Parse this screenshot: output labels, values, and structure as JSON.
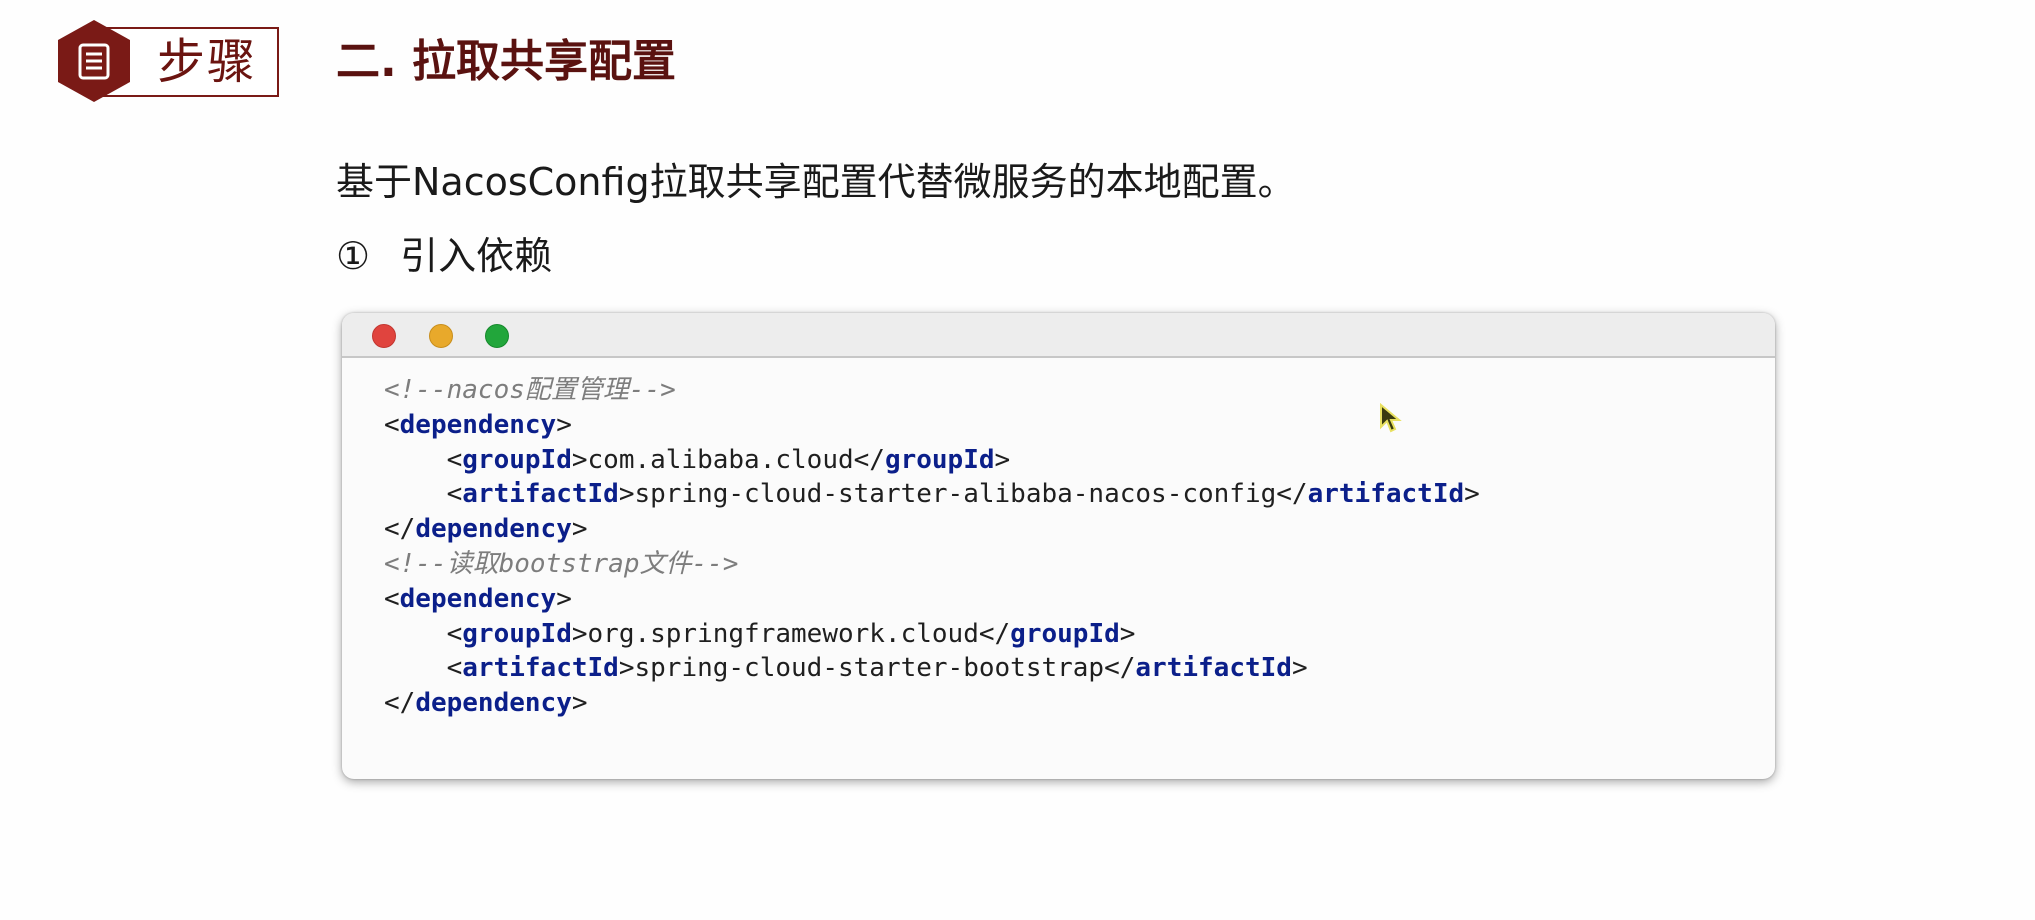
{
  "badge": {
    "label": "步骤",
    "icon": "document-icon",
    "color": "#7a1a16"
  },
  "section_title": "二. 拉取共享配置",
  "intro": "基于NacosConfig拉取共享配置代替微服务的本地配置。",
  "step": {
    "number": "①",
    "text": "引入依赖"
  },
  "code_window": {
    "window_buttons": [
      "close",
      "minimize",
      "maximize"
    ],
    "lines": [
      {
        "type": "comment",
        "text": "<!--nacos配置管理-->"
      },
      {
        "type": "open",
        "indent": 0,
        "tag": "dependency"
      },
      {
        "type": "element",
        "indent": 1,
        "tag": "groupId",
        "value": "com.alibaba.cloud"
      },
      {
        "type": "element",
        "indent": 1,
        "tag": "artifactId",
        "value": "spring-cloud-starter-alibaba-nacos-config"
      },
      {
        "type": "close",
        "indent": 0,
        "tag": "dependency"
      },
      {
        "type": "comment",
        "text": "<!--读取bootstrap文件-->"
      },
      {
        "type": "open",
        "indent": 0,
        "tag": "dependency"
      },
      {
        "type": "element",
        "indent": 1,
        "tag": "groupId",
        "value": "org.springframework.cloud"
      },
      {
        "type": "element",
        "indent": 1,
        "tag": "artifactId",
        "value": "spring-cloud-starter-bootstrap"
      },
      {
        "type": "close",
        "indent": 0,
        "tag": "dependency"
      }
    ]
  },
  "colors": {
    "accent": "#7a1a16",
    "tag": "#0b1f8a",
    "comment": "#7d7d7d"
  }
}
